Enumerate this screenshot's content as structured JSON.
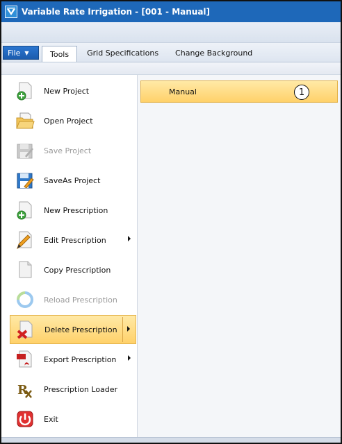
{
  "window": {
    "title": "Variable Rate Irrigation - [001 - Manual]",
    "app_icon": "valley-logo-icon"
  },
  "menubar": {
    "file_label": "File",
    "tabs": [
      {
        "label": "Tools",
        "selected": true
      },
      {
        "label": "Grid Specifications",
        "selected": false
      },
      {
        "label": "Change Background",
        "selected": false
      }
    ]
  },
  "file_menu": {
    "items": [
      {
        "label": "New Project",
        "icon": "new-project-icon",
        "enabled": true,
        "submenu": false
      },
      {
        "label": "Open Project",
        "icon": "open-folder-icon",
        "enabled": true,
        "submenu": false
      },
      {
        "label": "Save Project",
        "icon": "save-icon",
        "enabled": false,
        "submenu": false
      },
      {
        "label": "SaveAs Project",
        "icon": "save-as-icon",
        "enabled": true,
        "submenu": false
      },
      {
        "label": "New Prescription",
        "icon": "new-prescription-icon",
        "enabled": true,
        "submenu": false
      },
      {
        "label": "Edit Prescription",
        "icon": "edit-pencil-icon",
        "enabled": true,
        "submenu": true
      },
      {
        "label": "Copy Prescription",
        "icon": "copy-document-icon",
        "enabled": true,
        "submenu": false
      },
      {
        "label": "Reload Prescription",
        "icon": "reload-icon",
        "enabled": false,
        "submenu": false
      },
      {
        "label": "Delete Prescription",
        "icon": "delete-document-icon",
        "enabled": true,
        "submenu": true,
        "active": true
      },
      {
        "label": "Export Prescription",
        "icon": "pdf-export-icon",
        "enabled": true,
        "submenu": true
      },
      {
        "label": "Prescription Loader",
        "icon": "rx-icon",
        "enabled": true,
        "submenu": false
      },
      {
        "label": "Exit",
        "icon": "power-icon",
        "enabled": true,
        "submenu": false
      }
    ]
  },
  "submenu": {
    "items": [
      {
        "label": "Manual",
        "highlighted": true
      }
    ],
    "callout": "1"
  },
  "colors": {
    "titlebar": "#1e68b9",
    "highlight": "#ffd16a",
    "disabled_text": "#9a9a9a"
  }
}
